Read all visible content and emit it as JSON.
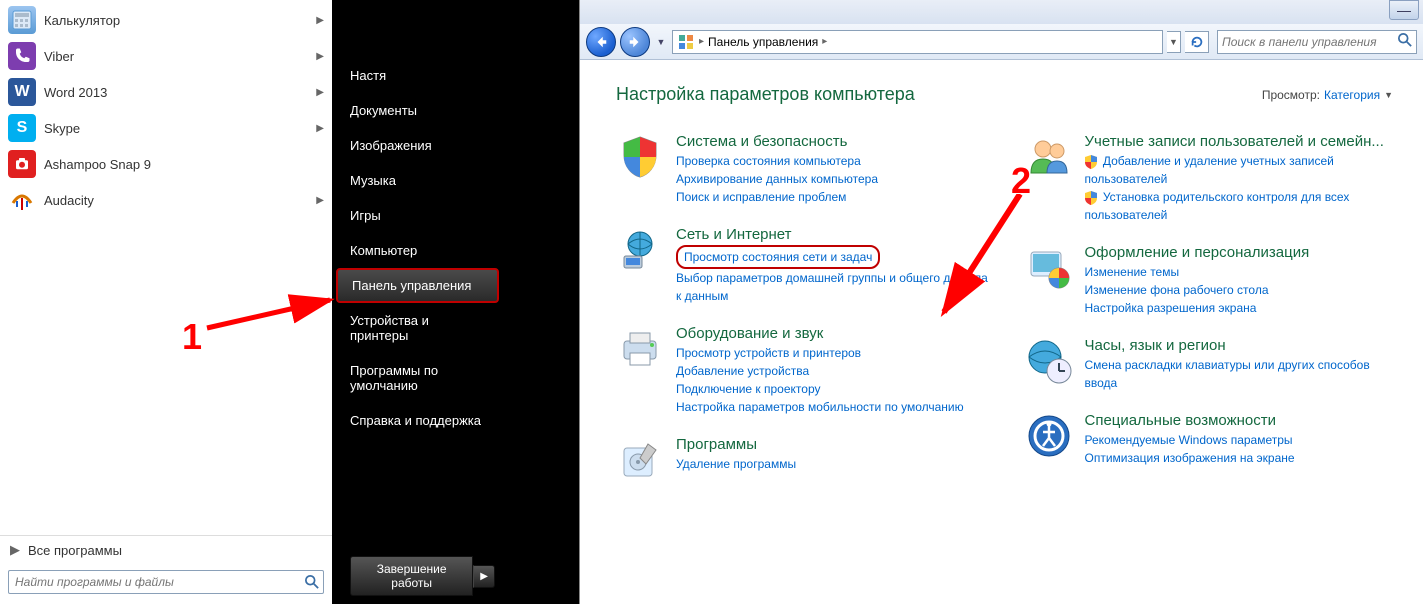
{
  "startmenu": {
    "programs": [
      {
        "label": "Калькулятор",
        "arrow": true
      },
      {
        "label": "Viber",
        "arrow": true
      },
      {
        "label": "Word 2013",
        "arrow": true
      },
      {
        "label": "Skype",
        "arrow": true
      },
      {
        "label": "Ashampoo Snap 9",
        "arrow": false
      },
      {
        "label": "Audacity",
        "arrow": true
      }
    ],
    "all_programs": "Все программы",
    "search_placeholder": "Найти программы и файлы",
    "right_items": [
      "Настя",
      "Документы",
      "Изображения",
      "Музыка",
      "Игры",
      "Компьютер",
      "Панель управления",
      "Устройства и принтеры",
      "Программы по умолчанию",
      "Справка и поддержка"
    ],
    "shutdown": "Завершение работы"
  },
  "annotations": {
    "num1": "1",
    "num2": "2"
  },
  "cp": {
    "breadcrumb": "Панель управления",
    "search_placeholder": "Поиск в панели управления",
    "title": "Настройка параметров компьютера",
    "view_label": "Просмотр:",
    "view_value": "Категория",
    "cats_left": [
      {
        "title": "Система и безопасность",
        "links": [
          "Проверка состояния компьютера",
          "Архивирование данных компьютера",
          "Поиск и исправление проблем"
        ]
      },
      {
        "title": "Сеть и Интернет",
        "links": [
          "Просмотр состояния сети и задач",
          "Выбор параметров домашней группы и общего доступа к данным"
        ]
      },
      {
        "title": "Оборудование и звук",
        "links": [
          "Просмотр устройств и принтеров",
          "Добавление устройства",
          "Подключение к проектору",
          "Настройка параметров мобильности по умолчанию"
        ]
      },
      {
        "title": "Программы",
        "links": [
          "Удаление программы"
        ]
      }
    ],
    "cats_right": [
      {
        "title": "Учетные записи пользователей и семейн...",
        "links": [
          "Добавление и удаление учетных записей пользователей",
          "Установка родительского контроля для всех пользователей"
        ],
        "uac": [
          true,
          true
        ]
      },
      {
        "title": "Оформление и персонализация",
        "links": [
          "Изменение темы",
          "Изменение фона рабочего стола",
          "Настройка разрешения экрана"
        ]
      },
      {
        "title": "Часы, язык и регион",
        "links": [
          "Смена раскладки клавиатуры или других способов ввода"
        ]
      },
      {
        "title": "Специальные возможности",
        "links": [
          "Рекомендуемые Windows параметры",
          "Оптимизация изображения на экране"
        ]
      }
    ]
  }
}
